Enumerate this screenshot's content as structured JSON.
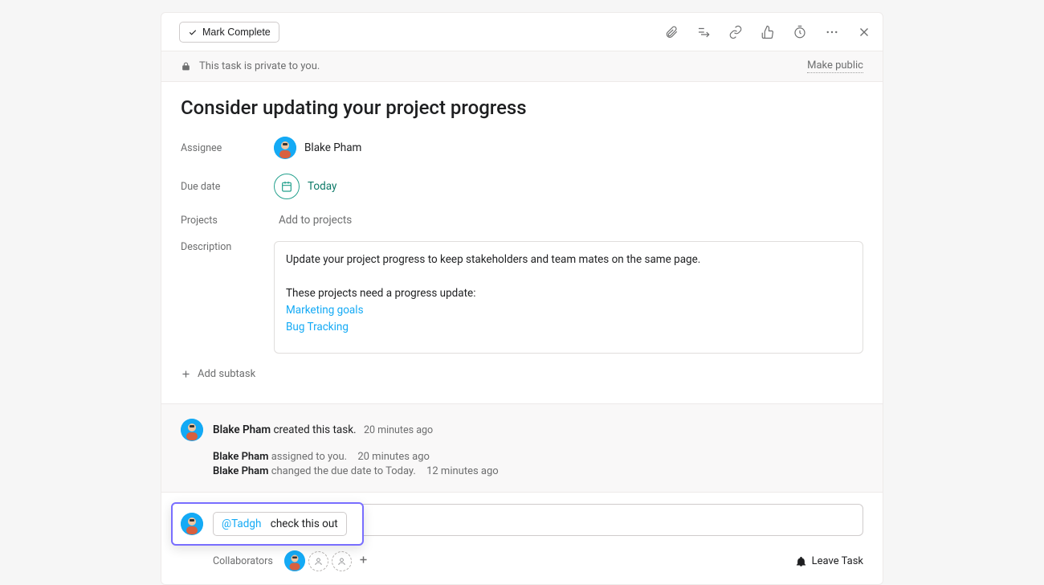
{
  "toolbar": {
    "mark_complete_label": "Mark Complete"
  },
  "privacy": {
    "message": "This task is private to you.",
    "make_public": "Make public"
  },
  "task": {
    "title": "Consider updating your project progress",
    "labels": {
      "assignee": "Assignee",
      "due_date": "Due date",
      "projects": "Projects",
      "description": "Description"
    },
    "assignee": {
      "name": "Blake Pham"
    },
    "due_date": {
      "text": "Today"
    },
    "projects_placeholder": "Add to projects",
    "description": {
      "line1": "Update your project progress to keep stakeholders and team mates on the same page.",
      "line2": "These projects need a progress update:",
      "links": [
        {
          "label": "Marketing goals"
        },
        {
          "label": "Bug Tracking"
        }
      ]
    },
    "add_subtask_label": "Add subtask"
  },
  "activity": {
    "created": {
      "name": "Blake Pham",
      "text": "created this task.",
      "time": "20 minutes ago"
    },
    "events": [
      {
        "name": "Blake Pham",
        "text": "assigned to you.",
        "time": "20 minutes ago"
      },
      {
        "name": "Blake Pham",
        "text": "changed the due date to Today.",
        "time": "12 minutes ago"
      }
    ]
  },
  "composer": {
    "mention": "@Tadgh",
    "draft_rest": "check this out"
  },
  "footer": {
    "collaborators_label": "Collaborators",
    "leave_label": "Leave Task"
  }
}
